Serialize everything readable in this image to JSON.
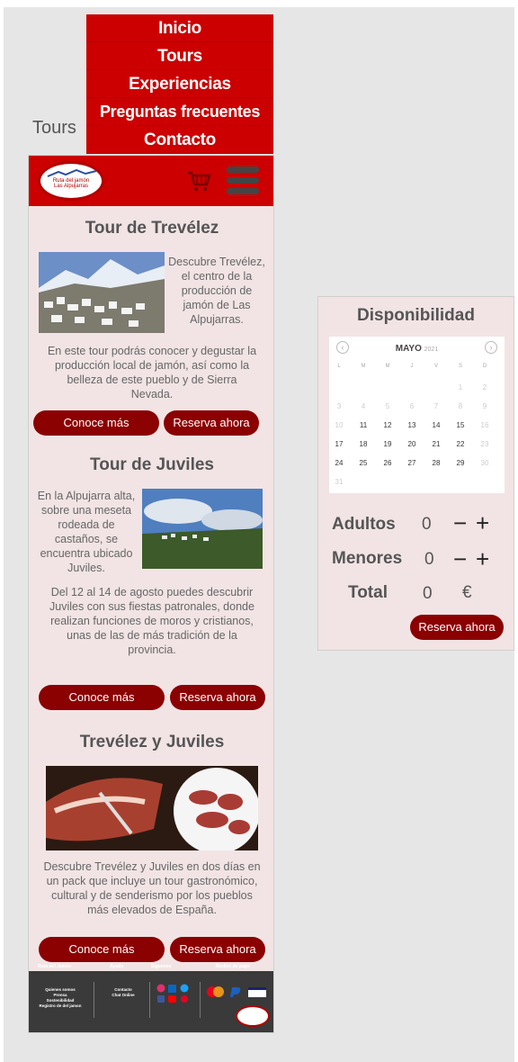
{
  "nav": {
    "items": [
      "Inicio",
      "Tours",
      "Experiencias",
      "Preguntas frecuentes",
      "Contacto"
    ]
  },
  "page_label": "Tours",
  "logo": {
    "text_line1": "Ruta del jamón",
    "text_line2": "Las Alpujarras"
  },
  "tours": [
    {
      "title": "Tour de Trevélez",
      "text_side": "Descubre Trevélez, el centro de la producción de jamón de Las Alpujarras.",
      "text_full": "En este tour podrás conocer y degustar la producción local de jamón, así como la belleza de este pueblo y de Sierra Nevada.",
      "more_label": "Conoce más",
      "book_label": "Reserva ahora"
    },
    {
      "title": "Tour de Juviles",
      "text_side": "En la Alpujarra alta, sobre una meseta rodeada de castaños, se encuentra ubicado Juviles.",
      "text_full": "Del 12 al 14 de agosto puedes descubrir Juviles con sus fiestas patronales, donde realizan funciones de moros y cristianos, unas de las de más tradición de la provincia.",
      "more_label": "Conoce más",
      "book_label": "Reserva ahora"
    },
    {
      "title": "Trevélez y Juviles",
      "text_full": "Descubre Trevélez y Juviles en dos días en un pack que incluye un tour gastronómico, cultural y de senderismo por los pueblos más elevados de España.",
      "more_label": "Conoce más",
      "book_label": "Reserva ahora"
    }
  ],
  "footer": {
    "headings": [
      "Ruta del Jamon",
      "Ayuda",
      "Siguenos",
      "Medios de pago"
    ],
    "col1": [
      "Quienes somos",
      "Prensa",
      "Sostenibilidad",
      "Registro de del jamon"
    ],
    "col2": [
      "Contacto",
      "Chat Online"
    ]
  },
  "availability": {
    "title": "Disponibilidad",
    "calendar": {
      "month": "MAYO",
      "year": "2021",
      "weekdays": [
        "L",
        "M",
        "M",
        "J",
        "V",
        "S",
        "D"
      ],
      "weeks": [
        [
          "",
          "",
          "",
          "",
          "",
          "1",
          "2"
        ],
        [
          "3",
          "4",
          "5",
          "6",
          "7",
          "8",
          "9"
        ],
        [
          "10",
          "11",
          "12",
          "13",
          "14",
          "15",
          "16"
        ],
        [
          "17",
          "18",
          "19",
          "20",
          "21",
          "22",
          "23"
        ],
        [
          "24",
          "25",
          "26",
          "27",
          "28",
          "29",
          "30"
        ],
        [
          "31",
          "",
          "",
          "",
          "",
          "",
          ""
        ]
      ]
    },
    "adults_label": "Adultos",
    "adults_value": "0",
    "minors_label": "Menores",
    "minors_value": "0",
    "total_label": "Total",
    "total_value": "0",
    "currency": "€",
    "minus": "−",
    "plus": "+",
    "book_label": "Reserva ahora"
  },
  "colors": {
    "brand_red": "#cc0000",
    "button_dark_red": "#8b0000",
    "card_bg": "#f2e4e4"
  }
}
